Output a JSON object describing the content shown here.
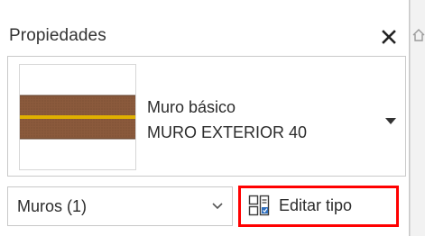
{
  "panel": {
    "title": "Propiedades"
  },
  "type_selector": {
    "family": "Muro básico",
    "type": "MURO EXTERIOR 40",
    "thumbnail_icon": "wall-section-thumbnail"
  },
  "category_filter": {
    "selected": "Muros (1)"
  },
  "edit_type": {
    "label": "Editar tipo",
    "icon": "edit-type-icon",
    "highlight_color": "#ff0000"
  },
  "colors": {
    "wall_fill": "#8b5a3c",
    "wall_core_line": "#e0b000"
  }
}
